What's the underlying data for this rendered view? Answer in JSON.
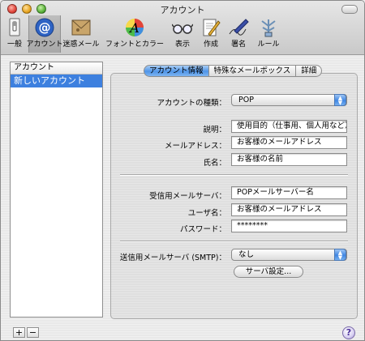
{
  "window": {
    "title": "アカウント"
  },
  "toolbar": {
    "items": [
      {
        "label": "一般",
        "icon": "light-switch-icon"
      },
      {
        "label": "アカウント",
        "icon": "at-sign-icon",
        "selected": true
      },
      {
        "label": "迷惑メール",
        "icon": "junk-mail-icon"
      },
      {
        "label": "フォントとカラー",
        "icon": "font-color-icon"
      },
      {
        "label": "表示",
        "icon": "glasses-icon"
      },
      {
        "label": "作成",
        "icon": "compose-icon"
      },
      {
        "label": "署名",
        "icon": "signature-pen-icon"
      },
      {
        "label": "ルール",
        "icon": "rules-icon"
      }
    ]
  },
  "sidebar": {
    "header": "アカウント",
    "items": [
      {
        "label": "新しいアカウント",
        "selected": true
      }
    ],
    "add_label": "+",
    "remove_label": "−"
  },
  "tabs": [
    {
      "label": "アカウント情報",
      "selected": true
    },
    {
      "label": "特殊なメールボックス"
    },
    {
      "label": "詳細"
    }
  ],
  "form": {
    "account_type": {
      "label": "アカウントの種類：",
      "value": "POP"
    },
    "description": {
      "label": "説明：",
      "value": "使用目的（仕事用、個人用など）"
    },
    "email": {
      "label": "メールアドレス：",
      "value": "お客様のメールアドレス"
    },
    "full_name": {
      "label": "氏名：",
      "value": "お客様の名前"
    },
    "incoming_server": {
      "label": "受信用メールサーバ：",
      "value": "POPメールサーバー名"
    },
    "user_name": {
      "label": "ユーザ名：",
      "value": "お客様のメールアドレス"
    },
    "password": {
      "label": "パスワード：",
      "value": "********"
    },
    "smtp": {
      "label": "送信用メールサーバ (SMTP)：",
      "value": "なし"
    },
    "server_settings_button": "サーバ設定..."
  },
  "help_label": "?",
  "colors": {
    "accent": "#3d80df",
    "tab_selected": "#4f95e8"
  }
}
